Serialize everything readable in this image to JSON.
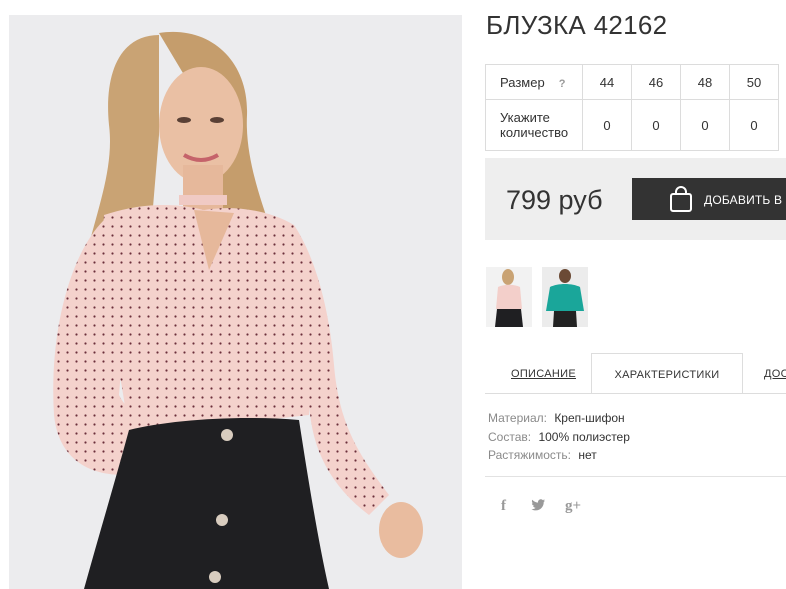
{
  "product": {
    "title": "БЛУЗКА 42162",
    "price": "799 руб",
    "add_button_label": "ДОБАВИТЬ В З",
    "image_alt": "Розовая блузка в мелкий горошек"
  },
  "sizes": {
    "size_label": "Размер",
    "help_glyph": "?",
    "qty_label_line1": "Укажите",
    "qty_label_line2": "количество",
    "values": [
      "44",
      "46",
      "48",
      "50"
    ],
    "quantities": [
      "0",
      "0",
      "0",
      "0"
    ]
  },
  "tabs": [
    {
      "label": "ОПИСАНИЕ"
    },
    {
      "label": "ХАРАКТЕРИСТИКИ"
    },
    {
      "label": "ДОС"
    }
  ],
  "specs": [
    {
      "key": "Материал:",
      "value": "Креп-шифон"
    },
    {
      "key": "Состав:",
      "value": "100% полиэстер"
    },
    {
      "key": "Растяжимость:",
      "value": "нет"
    }
  ],
  "social": {
    "facebook": "f",
    "twitter": "t",
    "googleplus": "g+"
  },
  "colors": {
    "blouse": "#f3cfca",
    "skirt": "#1f1f22",
    "price_box": "#eeeeee",
    "button": "#333333",
    "thumb2_top": "#1aa69a"
  }
}
